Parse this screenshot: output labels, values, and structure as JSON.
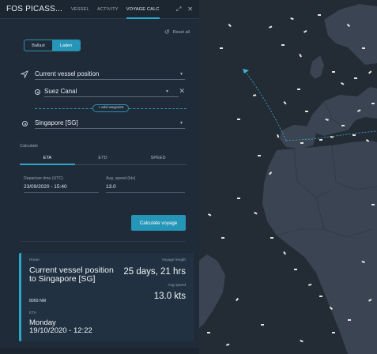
{
  "header": {
    "vessel_name": "FOS PICASS...",
    "tabs": [
      "VESSEL",
      "ACTIVITY",
      "VOYAGE CALC"
    ],
    "active_tab": "VOYAGE CALC",
    "expand_icon": "expand-icon",
    "close_icon": "close-icon"
  },
  "controls": {
    "reset_label": "Reset all",
    "reset_icon": "reset-icon",
    "load_toggle": {
      "options": [
        "Ballast",
        "Laden"
      ],
      "selected": "Laden"
    }
  },
  "route": {
    "origin": "Current vessel position",
    "waypoint": "Suez Canal",
    "add_waypoint": "+ add waypoint",
    "destination": "Singapore [SG]"
  },
  "calculate": {
    "label": "Calculate",
    "tabs": [
      "ETA",
      "ETD",
      "SPEED"
    ],
    "active_tab": "ETA",
    "departure_label": "Departure time (UTC)",
    "departure_value": "23/09/2020 - 15:40",
    "speed_label": "Avg. speed (kts)",
    "speed_value": "13.0",
    "button_label": "Calculate voyage"
  },
  "result": {
    "route_label": "Route",
    "route_value": "Current vessel position to Singapore [SG]",
    "length_label": "Voyage length",
    "length_value": "25 days, 21 hrs",
    "distance": "8069 NM",
    "speed_label": "Avg speed",
    "speed_value": "13.0 kts",
    "eta_label": "ETA",
    "eta_day": "Monday",
    "eta_datetime": "19/10/2020 - 12:22"
  },
  "colors": {
    "accent": "#2596b8",
    "panel_bg": "#1f2b38",
    "map_land": "#3b4452",
    "map_sea": "#232b35",
    "vessel_marker": "#e8e4dc"
  }
}
